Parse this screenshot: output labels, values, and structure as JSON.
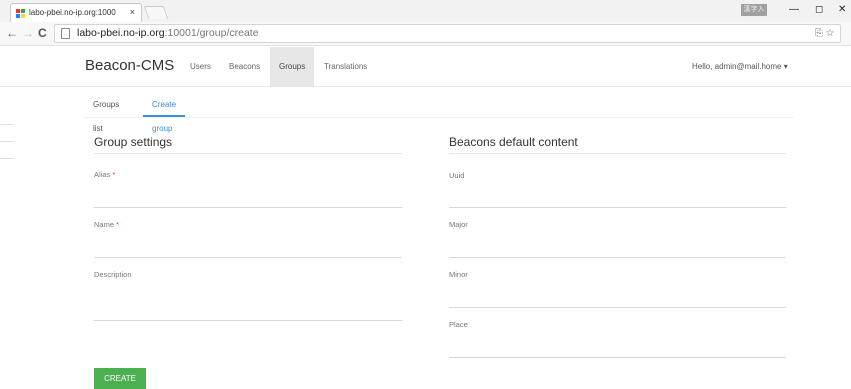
{
  "browser": {
    "tab_title": "labo-pbei.no-ip.org:1000",
    "tab_close": "×",
    "window_badge": "漢字入力",
    "window_controls": {
      "minimize": "—",
      "maximize": "◻",
      "close": "✕"
    },
    "url_host": "labo-pbei.no-ip.org",
    "url_path": ":10001/group/create",
    "nav": {
      "back": "←",
      "forward": "→",
      "reload": "C"
    },
    "omnibox_icons": "⎘ ☆"
  },
  "appbar": {
    "brand": "Beacon-CMS",
    "nav_items": [
      {
        "label": "Users",
        "active": false
      },
      {
        "label": "Beacons",
        "active": false
      },
      {
        "label": "Groups",
        "active": true
      },
      {
        "label": "Translations",
        "active": false
      }
    ],
    "user_menu": "Hello, admin@mail.home ▾"
  },
  "subtabs": [
    {
      "label": "Groups list",
      "active": false
    },
    {
      "label": "Create group",
      "active": true
    }
  ],
  "group_settings": {
    "title": "Group settings",
    "alias_label": "Alias",
    "name_label": "Name",
    "description_label": "Description",
    "required_mark": "*"
  },
  "beacons_default": {
    "title": "Beacons default content",
    "uuid_label": "Uuid",
    "major_label": "Major",
    "minor_label": "Minor",
    "place_label": "Place"
  },
  "actions": {
    "create_label": "CREATE"
  },
  "colors": {
    "accent": "#3a8fd6",
    "create_button": "#4caf50",
    "required": "#e53935"
  }
}
